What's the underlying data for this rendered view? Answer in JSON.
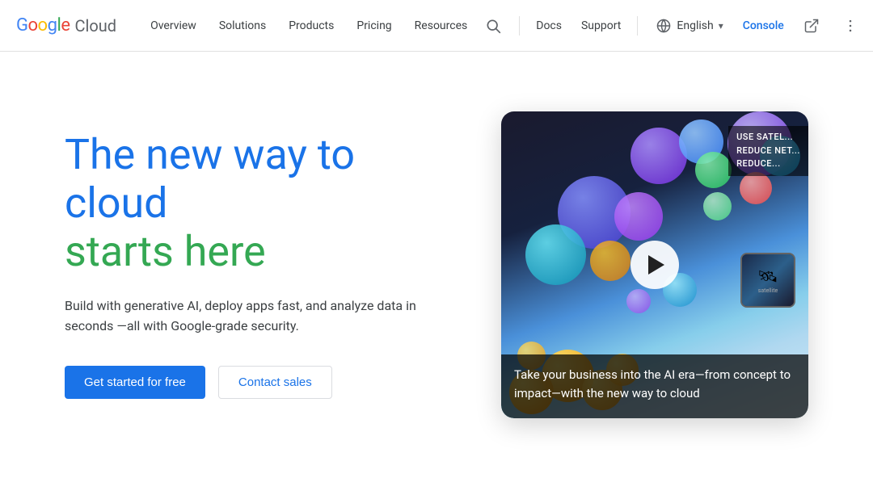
{
  "navbar": {
    "logo": {
      "google": "Google",
      "cloud": "Cloud"
    },
    "links": [
      {
        "id": "overview",
        "label": "Overview"
      },
      {
        "id": "solutions",
        "label": "Solutions"
      },
      {
        "id": "products",
        "label": "Products"
      },
      {
        "id": "pricing",
        "label": "Pricing"
      },
      {
        "id": "resources",
        "label": "Resources"
      }
    ],
    "docs_label": "Docs",
    "support_label": "Support",
    "language": {
      "label": "English",
      "icon": "globe-icon"
    },
    "console_label": "Console"
  },
  "hero": {
    "heading_line1": "The new way to cloud",
    "heading_line2": "starts here",
    "subtext": "Build with generative AI, deploy apps fast, and analyze data in seconds\n—all with Google-grade security.",
    "cta_primary": "Get started for free",
    "cta_secondary": "Contact sales"
  },
  "video": {
    "top_text_line1": "USE SATEL...",
    "top_text_line2": "REDUCE NET...",
    "top_text_line3": "REDUCE...",
    "caption": "Take your business into the AI era—from concept to impact—with the new way to cloud",
    "mini_card_label": "satellite",
    "play_label": "Play video"
  }
}
